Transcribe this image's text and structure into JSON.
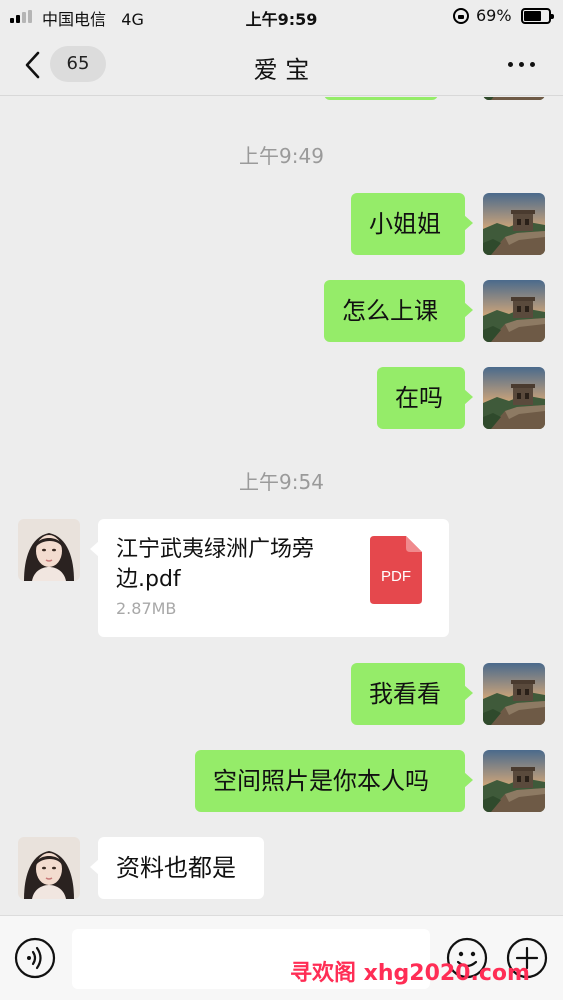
{
  "status_bar": {
    "carrier": "中国电信",
    "network": "4G",
    "time": "上午9:59",
    "battery": "69%",
    "battery_level": 0.69
  },
  "header": {
    "back_badge": "65",
    "title": "爱 宝",
    "back_icon": "chevron-left-icon",
    "more_icon": "more-dots-icon"
  },
  "messages": {
    "timestamp_1": "上午9:49",
    "msg_1": "小姐姐",
    "msg_2": "怎么上课",
    "msg_3": "在吗",
    "timestamp_2": "上午9:54",
    "file": {
      "name": "江宁武夷绿洲广场旁边.pdf",
      "size": "2.87MB",
      "type_label": "PDF"
    },
    "msg_4": "我看看",
    "msg_5": "空间照片是你本人吗",
    "msg_6": "资料也都是"
  },
  "input_bar": {
    "text_value": "",
    "voice_icon": "voice-icon",
    "emoji_icon": "emoji-icon",
    "plus_icon": "plus-icon"
  },
  "watermark": "寻欢阁 xhg2020.com",
  "colors": {
    "outgoing_bubble": "#95ec69",
    "incoming_bubble": "#ffffff",
    "background": "#ededed",
    "pdf_red": "#e5484d"
  }
}
